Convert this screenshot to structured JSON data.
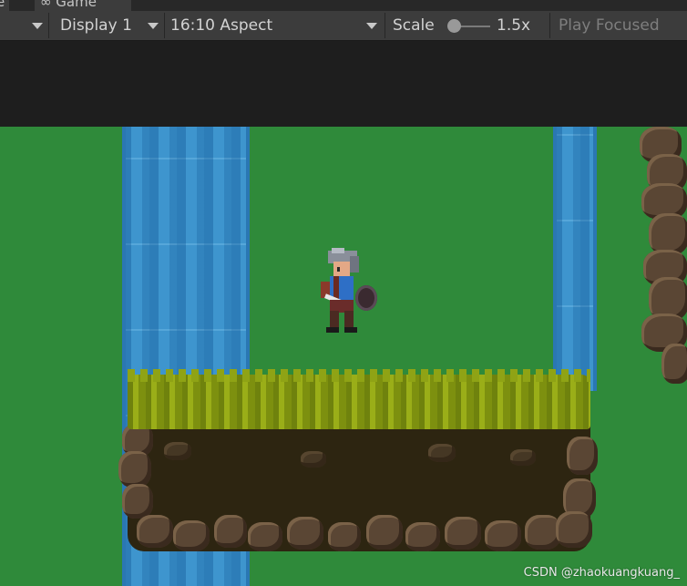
{
  "tabs": {
    "prev_fragment": "e",
    "game_label": "Game",
    "game_icon": "gamepad-icon"
  },
  "toolbar": {
    "display": "Display 1",
    "aspect": "16:10 Aspect",
    "scale_label": "Scale",
    "scale_value": "1.5x",
    "play_mode": "Play Focused"
  },
  "scene": {
    "watermark": "CSDN @zhaokuangkuang_"
  },
  "colors": {
    "grass_bg": "#2f8a3a",
    "water": "#3a8fc9",
    "toolbar": "#3c3c3c"
  }
}
